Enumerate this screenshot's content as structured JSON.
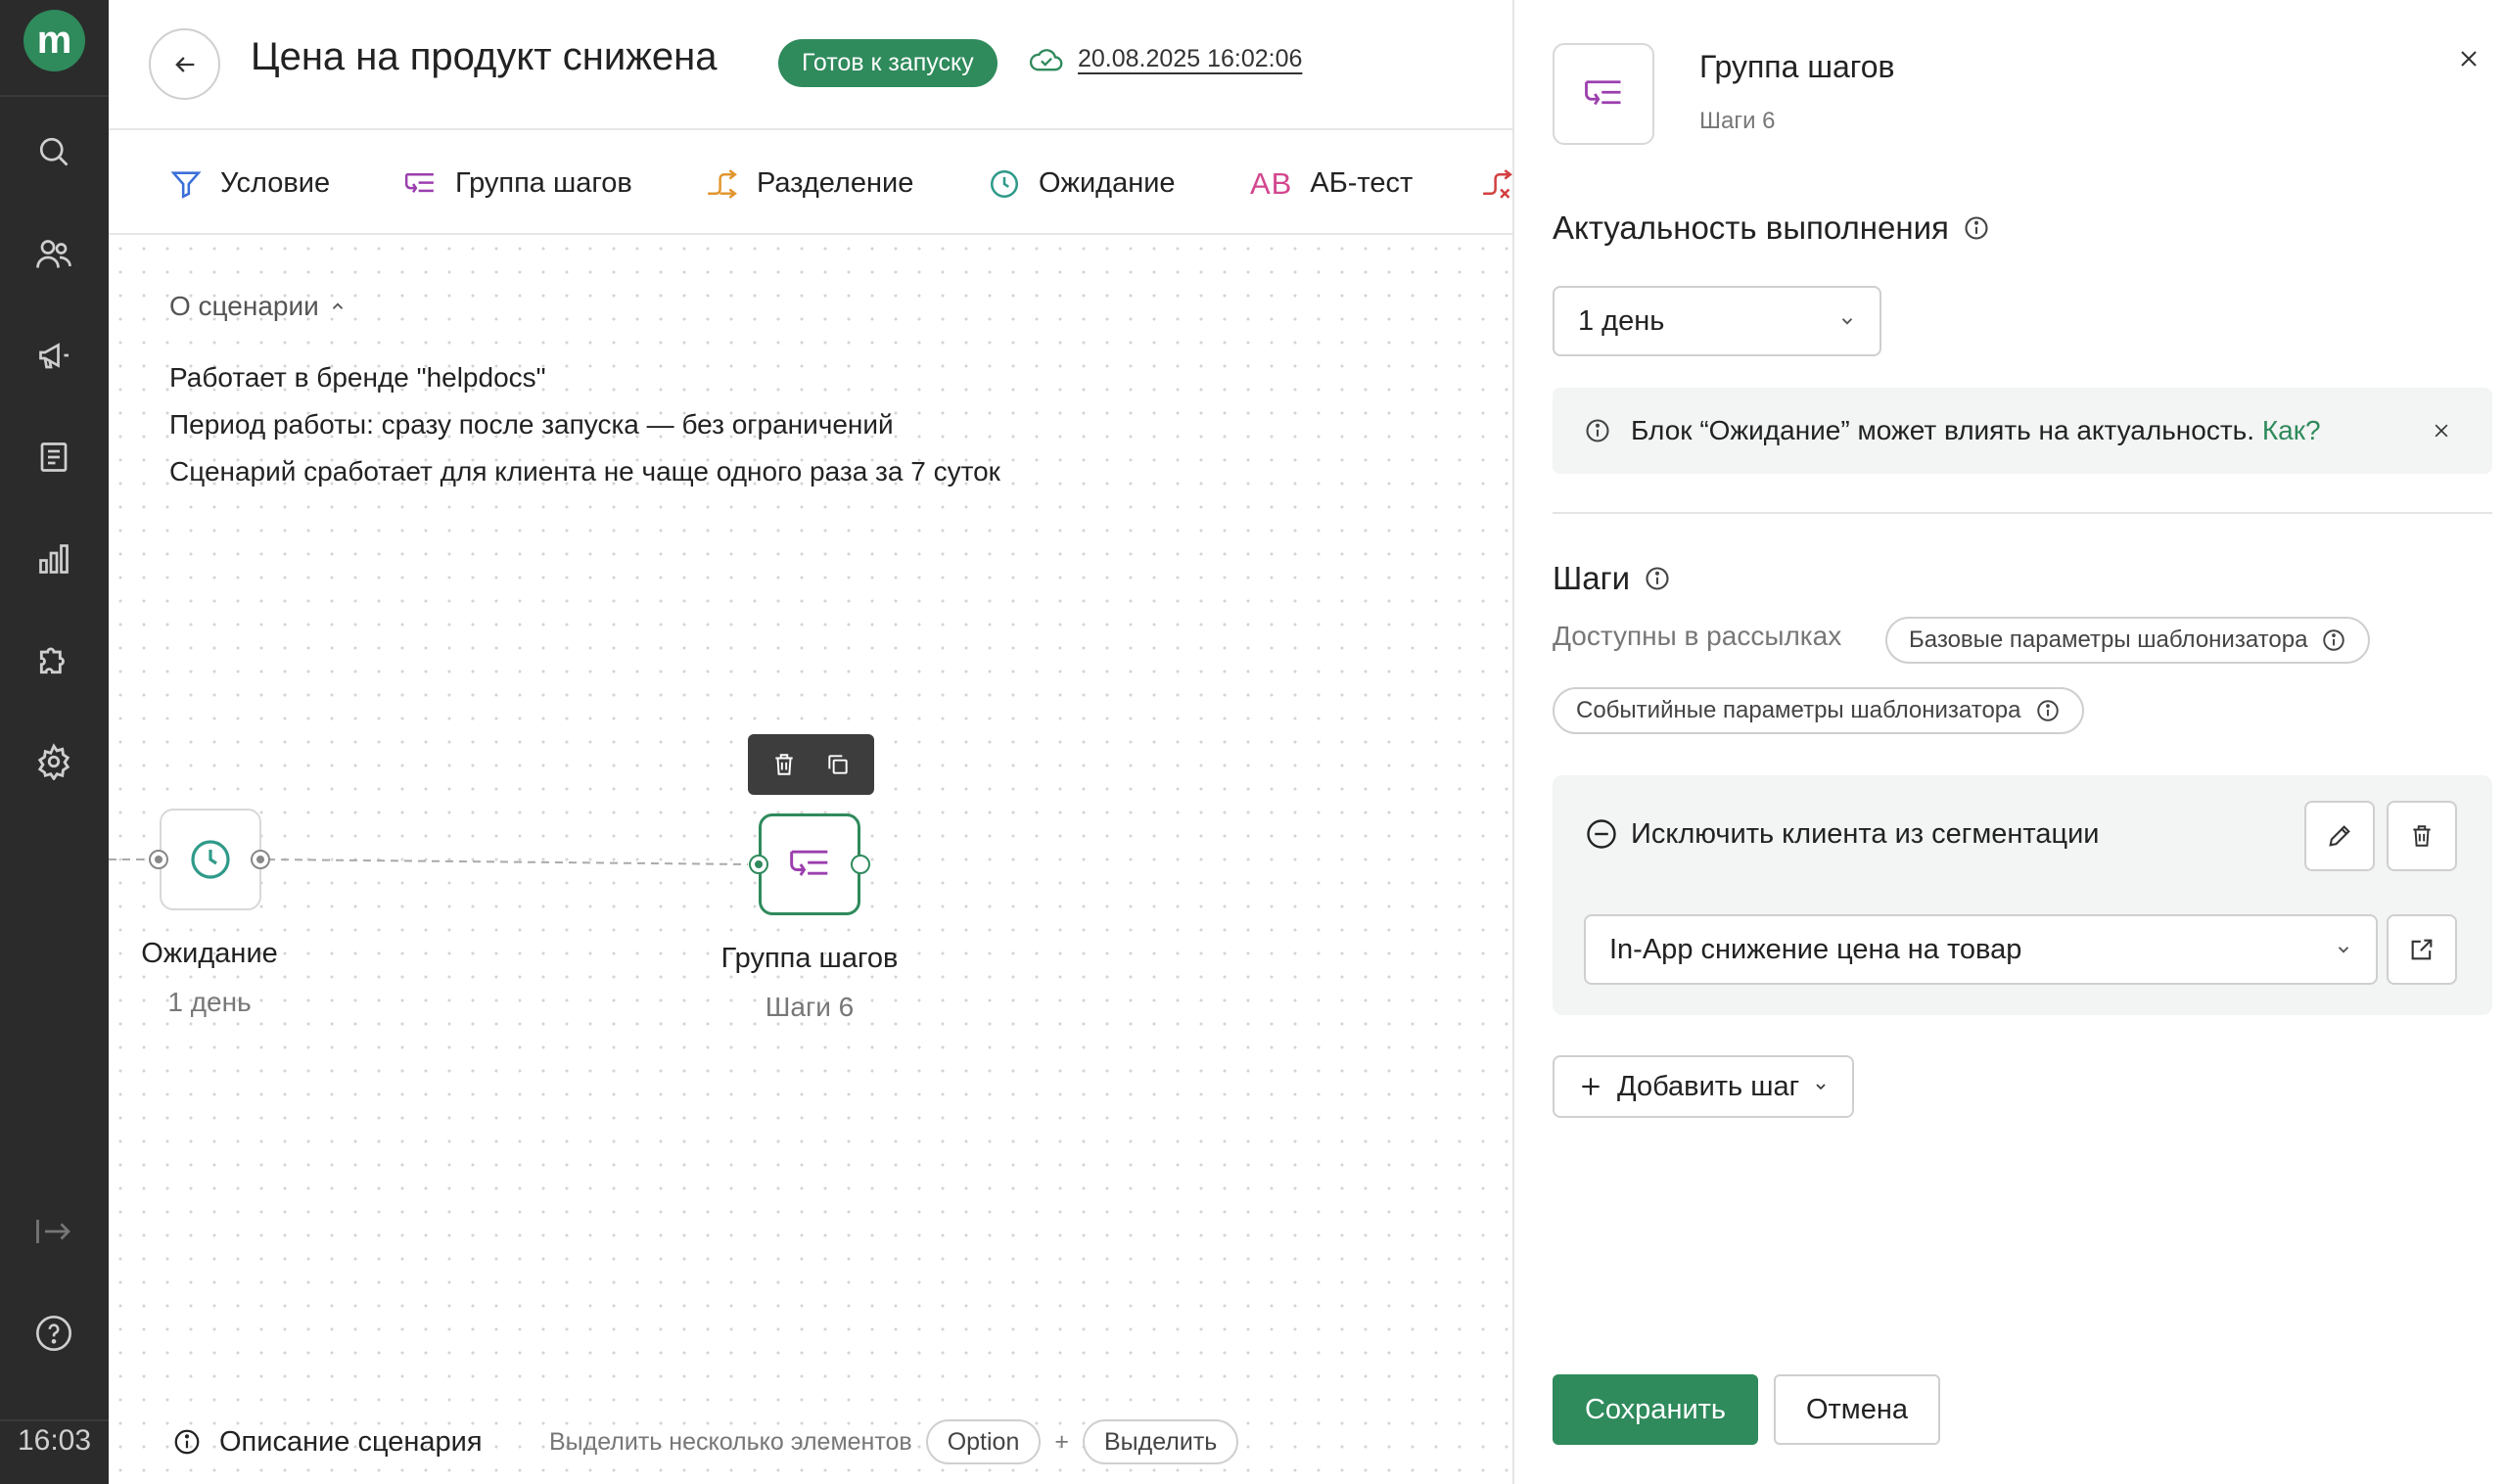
{
  "sidebar": {
    "logo": "m",
    "icons": [
      "search-icon",
      "users-icon",
      "megaphone-icon",
      "document-icon",
      "chart-icon",
      "puzzle-icon",
      "gear-icon",
      "logout-icon",
      "help-icon"
    ],
    "time": "16:03"
  },
  "header": {
    "title": "Цена на продукт снижена",
    "status_badge": "Готов к запуску",
    "saved_at": "20.08.2025 16:02:06"
  },
  "toolbar": {
    "items": [
      {
        "label": "Условие",
        "icon": "filter-icon"
      },
      {
        "label": "Группа шагов",
        "icon": "steps-group-icon"
      },
      {
        "label": "Разделение",
        "icon": "split-icon"
      },
      {
        "label": "Ожидание",
        "icon": "clock-icon"
      },
      {
        "label": "АБ-тест",
        "icon": "ab-test-icon"
      }
    ]
  },
  "canvas": {
    "about_label": "О сценарии",
    "about_lines": [
      "Работает в бренде \"helpdocs\"",
      "Период работы: сразу после запуска — без ограничений",
      "Сценарий сработает для клиента не чаще одного раза за 7 суток"
    ],
    "nodes": [
      {
        "label": "Ожидание",
        "sub": "1 день"
      },
      {
        "label": "Группа шагов",
        "sub": "Шаги 6"
      }
    ],
    "footer": {
      "description": "Описание сценария",
      "hint": "Выделить несколько элементов",
      "key1": "Option",
      "plus": "+",
      "key2": "Выделить"
    }
  },
  "panel": {
    "title": "Группа шагов",
    "subtitle": "Шаги 6",
    "relevance_heading": "Актуальность выполнения",
    "relevance_value": "1 день",
    "alert_text": "Блок “Ожидание” может влиять на актуальность.",
    "alert_link": "Как?",
    "steps_heading": "Шаги",
    "available_label": "Доступны в рассылках",
    "chips": [
      "Базовые параметры шаблонизатора",
      "Событийные параметры шаблонизатора"
    ],
    "step_title": "Исключить клиента из сегментации",
    "step_select_value": "In-App снижение цена на товар",
    "add_step_label": "Добавить шаг",
    "save_label": "Сохранить",
    "cancel_label": "Отмена"
  },
  "colors": {
    "brand_green": "#2f8a5c",
    "sidebar_bg": "#2b2b2b",
    "steps_purple": "#9b3fae",
    "teal": "#2f9a8a",
    "orange": "#e0962f",
    "pink": "#d2478e"
  }
}
